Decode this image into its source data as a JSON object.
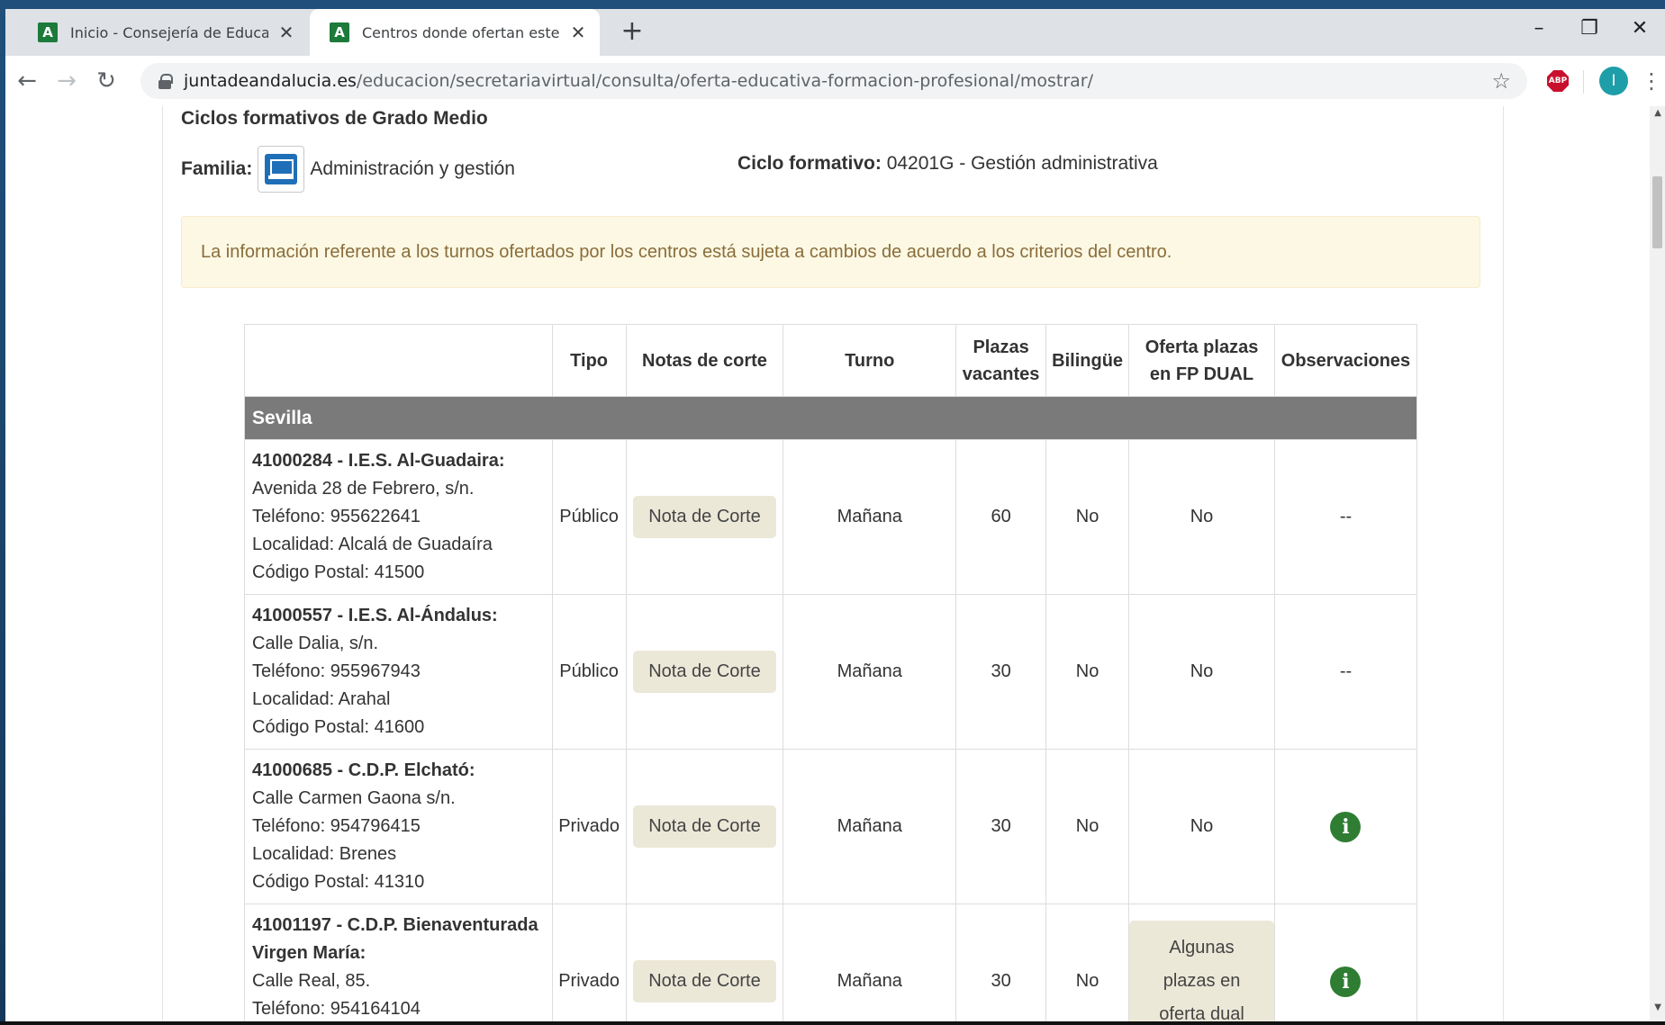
{
  "browser": {
    "tabs": [
      {
        "title": "Inicio - Consejería de Educación y",
        "favicon": "A"
      },
      {
        "title": "Centros donde ofertan este ciclo",
        "favicon": "A"
      }
    ],
    "new_tab_symbol": "+",
    "controls": {
      "minimize": "–",
      "maximize": "❐",
      "close": "✕"
    },
    "url_domain": "juntadeandalucia.es",
    "url_path": "/educacion/secretariavirtual/consulta/oferta-educativa-formacion-profesional/mostrar/",
    "extension_label": "ABP",
    "profile_initial": "I"
  },
  "page": {
    "section_title": "Ciclos formativos de Grado Medio",
    "familia_label": "Familia:",
    "familia_value": "Administración y gestión",
    "ciclo_label": "Ciclo formativo:",
    "ciclo_value": "04201G - Gestión administrativa",
    "alert_text": "La información referente a los turnos ofertados por los centros está sujeta a cambios de acuerdo a los criterios del centro.",
    "table": {
      "headers": [
        "",
        "Tipo",
        "Notas de corte",
        "Turno",
        "Plazas vacantes",
        "Bilingüe",
        "Oferta plazas en FP DUAL",
        "Observaciones"
      ],
      "group": "Sevilla",
      "rows": [
        {
          "name": "41000284 - I.E.S. Al-Guadaira:",
          "address": "Avenida 28 de Febrero, s/n.",
          "phone": "Teléfono: 955622641",
          "locality": "Localidad: Alcalá de Guadaíra",
          "postal": "Código Postal: 41500",
          "tipo": "Público",
          "nota": "Nota de Corte",
          "turno": "Mañana",
          "plazas": "60",
          "bilingue": "No",
          "dual": "No",
          "observaciones": "--"
        },
        {
          "name": "41000557 - I.E.S. Al-Ándalus:",
          "address": "Calle Dalia, s/n.",
          "phone": "Teléfono: 955967943",
          "locality": "Localidad: Arahal",
          "postal": "Código Postal: 41600",
          "tipo": "Público",
          "nota": "Nota de Corte",
          "turno": "Mañana",
          "plazas": "30",
          "bilingue": "No",
          "dual": "No",
          "observaciones": "--"
        },
        {
          "name": "41000685 - C.D.P. Elcható:",
          "address": "Calle Carmen Gaona s/n.",
          "phone": "Teléfono: 954796415",
          "locality": "Localidad: Brenes",
          "postal": "Código Postal: 41310",
          "tipo": "Privado",
          "nota": "Nota de Corte",
          "turno": "Mañana",
          "plazas": "30",
          "bilingue": "No",
          "dual": "No",
          "observaciones_icon": "info-icon"
        },
        {
          "name": "41001197 - C.D.P. Bienaventurada Virgen María:",
          "address": "Calle Real, 85.",
          "phone": "Teléfono: 954164104",
          "tipo": "Privado",
          "nota": "Nota de Corte",
          "turno": "Mañana",
          "plazas": "30",
          "bilingue": "No",
          "dual": "Algunas plazas en oferta dual",
          "observaciones_icon": "info-icon"
        }
      ]
    }
  }
}
